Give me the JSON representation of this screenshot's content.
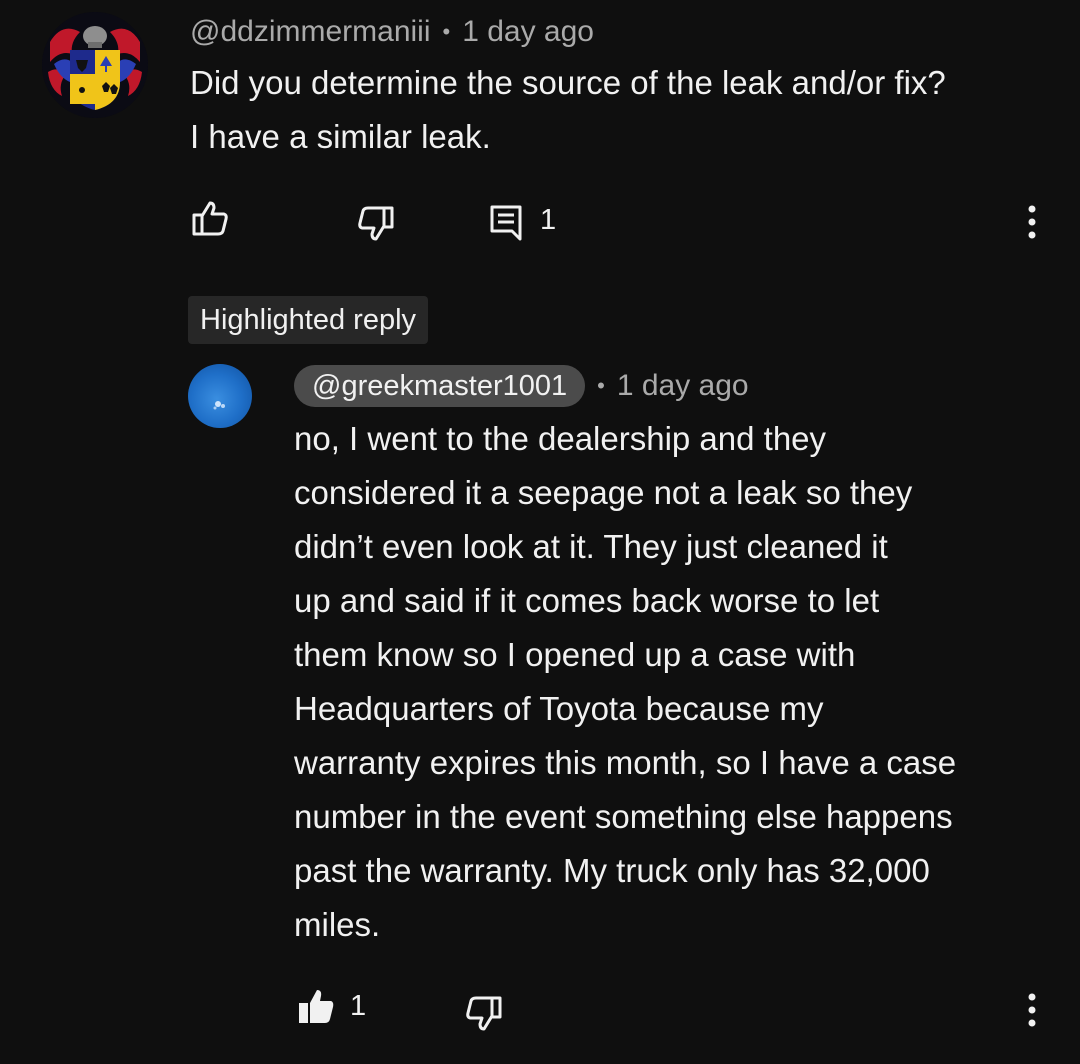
{
  "comment": {
    "author": "@ddzimmermaniii",
    "separator": "•",
    "time": "1 day ago",
    "text_lines": [
      "Did you determine the source of the leak and/or fix?",
      "I have a similar leak."
    ],
    "reply_count": "1",
    "icons": {
      "like": "thumbs-up-outline-icon",
      "dislike": "thumbs-down-outline-icon",
      "reply": "reply-comment-icon",
      "menu": "more-vertical-icon"
    }
  },
  "highlight_label": "Highlighted reply",
  "reply": {
    "author": "@greekmaster1001",
    "separator": "•",
    "time": "1 day ago",
    "text_lines": [
      "no, I went to the dealership and they",
      "considered it a seepage not a leak so they",
      "didn’t even look at it. They just cleaned it",
      "up and said if it comes back worse to let",
      "them know so I opened up a case with",
      "Headquarters of Toyota because my",
      "warranty expires this month, so I have a case",
      "number in the event something else happens",
      "past the warranty. My truck only has 32,000",
      "miles."
    ],
    "like_count": "1",
    "icons": {
      "like": "thumbs-up-filled-icon",
      "dislike": "thumbs-down-outline-icon",
      "menu": "more-vertical-icon"
    }
  },
  "colors": {
    "background": "#0f0f0f",
    "text": "#f1f1f1",
    "secondary_text": "#aaaaaa",
    "chip": "#4b4b4b",
    "badge": "#272727"
  }
}
